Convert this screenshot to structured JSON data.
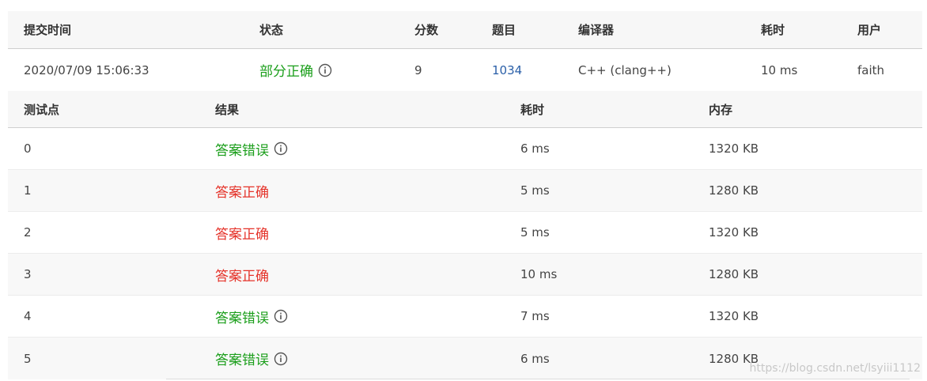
{
  "submission": {
    "headers": {
      "time": "提交时间",
      "status": "状态",
      "score": "分数",
      "problem": "题目",
      "compiler": "编译器",
      "duration": "耗时",
      "user": "用户"
    },
    "row": {
      "time": "2020/07/09 15:06:33",
      "status": "部分正确",
      "score": "9",
      "problem": "1034",
      "compiler": "C++ (clang++)",
      "duration": "10 ms",
      "user": "faith"
    }
  },
  "testcases": {
    "headers": {
      "id": "测试点",
      "result": "结果",
      "duration": "耗时",
      "memory": "内存"
    },
    "rows": [
      {
        "id": "0",
        "result": "答案错误",
        "duration": "6 ms",
        "memory": "1320 KB"
      },
      {
        "id": "1",
        "result": "答案正确",
        "duration": "5 ms",
        "memory": "1280 KB"
      },
      {
        "id": "2",
        "result": "答案正确",
        "duration": "5 ms",
        "memory": "1320 KB"
      },
      {
        "id": "3",
        "result": "答案正确",
        "duration": "10 ms",
        "memory": "1280 KB"
      },
      {
        "id": "4",
        "result": "答案错误",
        "duration": "7 ms",
        "memory": "1320 KB"
      },
      {
        "id": "5",
        "result": "答案错误",
        "duration": "6 ms",
        "memory": "1280 KB"
      }
    ]
  },
  "colors": {
    "wrong_answer": "#1a9e1a",
    "accepted": "#e5332a",
    "partial": "#1a9e1a",
    "link": "#2a5fa8"
  },
  "watermark": "https://blog.csdn.net/lsyiii1112"
}
